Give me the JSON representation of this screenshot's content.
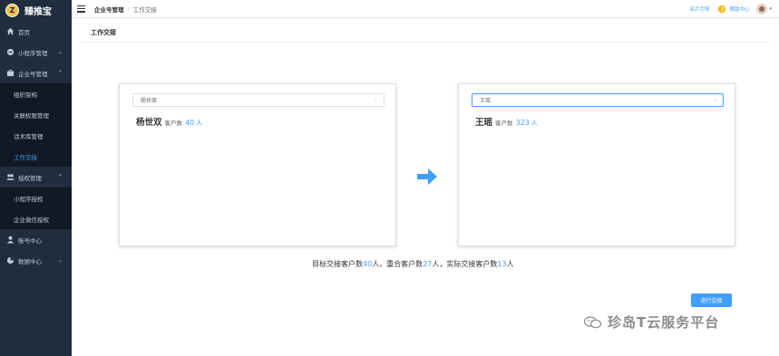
{
  "app": {
    "brand": "臻推宝",
    "logo_text": "Z"
  },
  "sidebar": {
    "items": [
      {
        "label": "首页",
        "icon": "home-icon"
      },
      {
        "label": "小程序管理",
        "icon": "miniprogram-icon"
      },
      {
        "label": "企业号管理",
        "icon": "briefcase-icon",
        "expanded": true
      },
      {
        "label": "组织架构"
      },
      {
        "label": "关联权限管理"
      },
      {
        "label": "话术库管理"
      },
      {
        "label": "工作交接",
        "active": true
      },
      {
        "label": "授权管理",
        "icon": "users-icon",
        "expanded": true
      },
      {
        "label": "小程序授权"
      },
      {
        "label": "企业微信授权"
      },
      {
        "label": "账号中心",
        "icon": "user-icon"
      },
      {
        "label": "数据中心",
        "icon": "chart-icon"
      }
    ]
  },
  "header": {
    "breadcrumb": [
      "企业号管理",
      "工作交接"
    ],
    "breadcrumb_sep": "/",
    "links": {
      "card_guide": "名片引导",
      "help": "帮助中心"
    }
  },
  "page": {
    "title": "工作交接"
  },
  "left_card": {
    "select_value": "杨世双",
    "name": "杨世双",
    "label": "客户数",
    "count": "40",
    "unit": "人"
  },
  "right_card": {
    "select_value": "王瑶",
    "name": "王瑶",
    "label": "客户数",
    "count": "323",
    "unit": "人"
  },
  "summary": {
    "p1": "目标交接客户数",
    "n1": "40",
    "p2": "人，重合客户数",
    "n2": "27",
    "p3": "人，实际交接客户数",
    "n3": "13",
    "p4": "人"
  },
  "submit_label": "进行交接",
  "watermark": "珍岛T云服务平台",
  "colors": {
    "accent": "#409eff",
    "sidebar": "#1f2d3d",
    "submenu": "#111a24"
  }
}
